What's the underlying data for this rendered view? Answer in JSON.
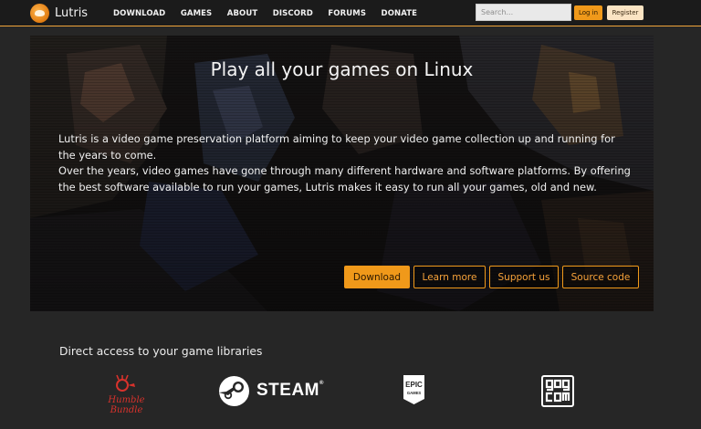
{
  "navbar": {
    "brand_name": "Lutris",
    "links": [
      "DOWNLOAD",
      "GAMES",
      "ABOUT",
      "DISCORD",
      "FORUMS",
      "DONATE"
    ],
    "search_placeholder": "Search...",
    "login_label": "Log in",
    "register_label": "Register"
  },
  "hero": {
    "title": "Play all your games on Linux",
    "paragraph_1": "Lutris is a video game preservation platform aiming to keep your video game collection up and running for the years to come.",
    "paragraph_2": "Over the years, video games have gone through many different hardware and software platforms. By offering the best software available to run your games, Lutris makes it easy to run all your games, old and new.",
    "buttons": {
      "download": "Download",
      "learn_more": "Learn more",
      "support_us": "Support us",
      "source_code": "Source code"
    }
  },
  "libraries": {
    "heading": "Direct access to your game libraries",
    "logos": [
      "Humble Bundle",
      "STEAM",
      "EPIC GAMES",
      "GOG.COM"
    ],
    "humble_text": "Humble Bundle",
    "steam_text": "STEAM",
    "epic_top": "EPIC",
    "epic_bottom": "GAMES"
  },
  "colors": {
    "accent": "#f0991a",
    "background": "#262626",
    "navbar": "#1b1b1b",
    "humble_red": "#d8322c"
  }
}
